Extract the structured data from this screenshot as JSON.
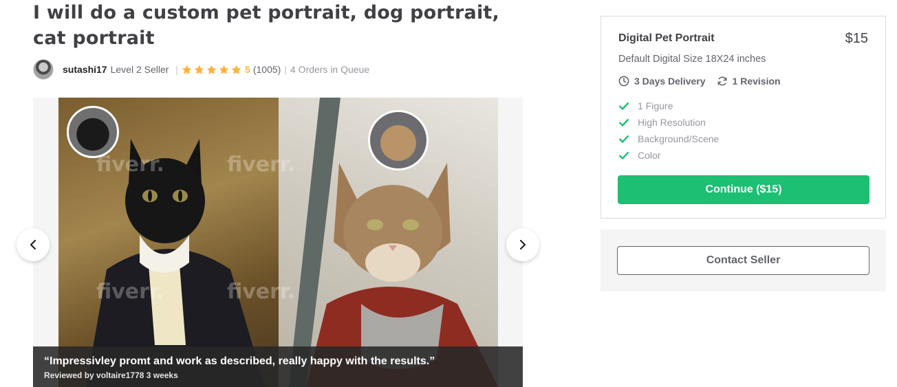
{
  "gig": {
    "title": "I will do a custom pet portrait, dog portrait, cat portrait"
  },
  "seller": {
    "username": "sutashi17",
    "level": "Level 2 Seller",
    "rating": "5",
    "review_count": "(1005)",
    "queue": "4 Orders in Queue"
  },
  "gallery": {
    "watermark": "fiverr.",
    "caption_quote": "“Impressivley promt and work as described, really happy with the results.”",
    "caption_reviewer": "Reviewed by voltaire1778 3 weeks"
  },
  "package": {
    "name": "Digital Pet Portrait",
    "price": "$15",
    "description": "Default Digital Size 18X24 inches",
    "delivery": "3 Days Delivery",
    "revisions": "1 Revision",
    "features": [
      "1 Figure",
      "High Resolution",
      "Background/Scene",
      "Color"
    ],
    "continue_label": "Continue ($15)"
  },
  "contact": {
    "label": "Contact Seller"
  },
  "colors": {
    "accent_green": "#1dbf73",
    "star_gold": "#ffb33e",
    "text_dark": "#404145"
  }
}
